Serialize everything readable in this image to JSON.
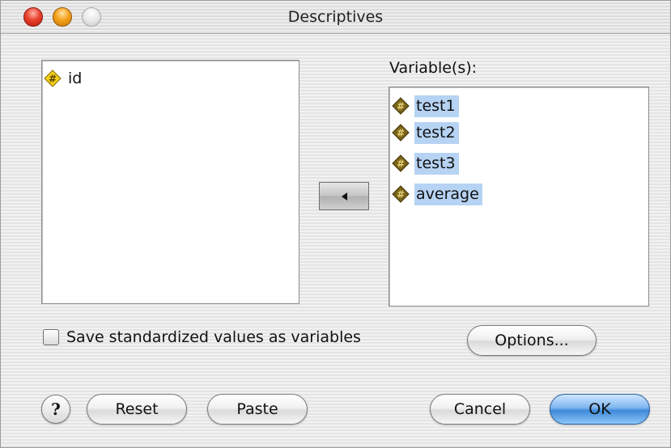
{
  "window": {
    "title": "Descriptives"
  },
  "source_list": {
    "items": [
      {
        "label": "id",
        "icon": "numeric-variable-icon",
        "selected": false
      }
    ]
  },
  "target_list": {
    "label": "Variable(s):",
    "items": [
      {
        "label": "test1",
        "icon": "numeric-variable-icon",
        "selected": true
      },
      {
        "label": "test2",
        "icon": "numeric-variable-icon",
        "selected": true
      },
      {
        "label": "test3",
        "icon": "numeric-variable-icon",
        "selected": true
      },
      {
        "label": "average",
        "icon": "numeric-variable-icon",
        "selected": true
      }
    ]
  },
  "move_button": {
    "icon": "arrow-left-icon"
  },
  "checkbox": {
    "label": "Save standardized values as variables",
    "checked": false
  },
  "buttons": {
    "help": "?",
    "options": "Options...",
    "reset": "Reset",
    "paste": "Paste",
    "cancel": "Cancel",
    "ok": "OK"
  },
  "colors": {
    "selection": "#b6d3f3",
    "default_button": "#3e8ad8",
    "variable_icon_source": "#f2cf1a",
    "variable_icon_target": "#7a6418"
  }
}
